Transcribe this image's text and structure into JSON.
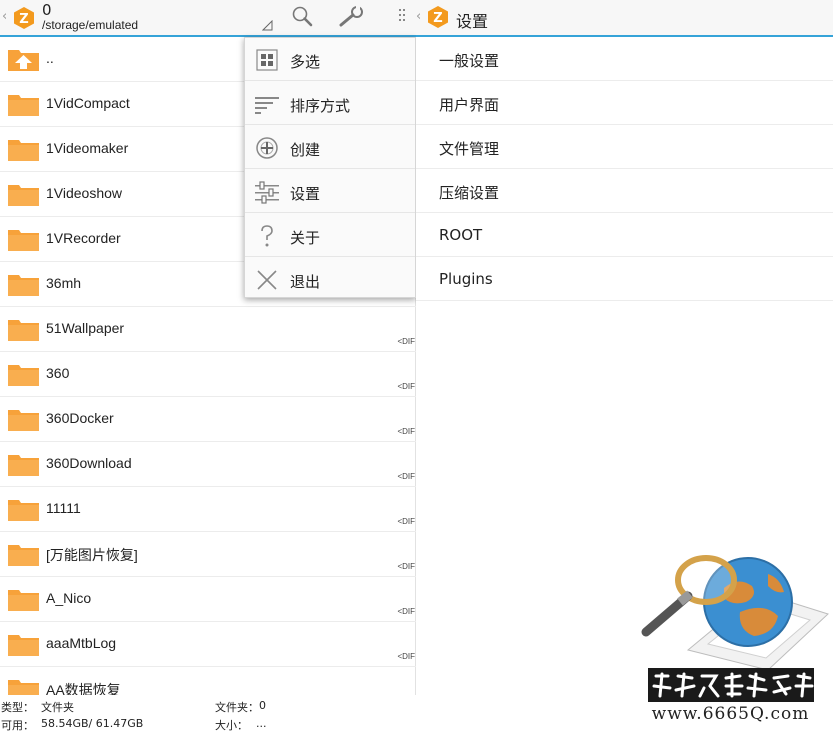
{
  "left_pane": {
    "header": {
      "back_glyph": "‹",
      "logo_letter": "Z",
      "count": "0",
      "path": "/storage/emulated",
      "icons": [
        "sort-triangle-icon",
        "search-icon",
        "wrench-icon",
        "overflow-menu-icon"
      ]
    },
    "files": [
      {
        "name": "..",
        "icon": "up-folder-icon",
        "tag": ""
      },
      {
        "name": "1VidCompact",
        "icon": "folder-icon",
        "tag": ""
      },
      {
        "name": "1Videomaker",
        "icon": "folder-icon",
        "tag": ""
      },
      {
        "name": "1Videoshow",
        "icon": "folder-icon",
        "tag": ""
      },
      {
        "name": "1VRecorder",
        "icon": "folder-icon",
        "tag": ""
      },
      {
        "name": "36mh",
        "icon": "folder-icon",
        "tag": ""
      },
      {
        "name": "51Wallpaper",
        "icon": "folder-icon",
        "tag": "<DIF"
      },
      {
        "name": "360",
        "icon": "folder-icon",
        "tag": "<DIF"
      },
      {
        "name": "360Docker",
        "icon": "folder-icon",
        "tag": "<DIF"
      },
      {
        "name": "360Download",
        "icon": "folder-icon",
        "tag": "<DIF"
      },
      {
        "name": "11111",
        "icon": "folder-icon",
        "tag": "<DIF"
      },
      {
        "name": "[万能图片恢复]",
        "icon": "folder-icon",
        "tag": "<DIF"
      },
      {
        "name": "A_Nico",
        "icon": "folder-icon",
        "tag": "<DIF"
      },
      {
        "name": "aaaMtbLog",
        "icon": "folder-icon",
        "tag": "<DIF"
      },
      {
        "name": "AA数据恢复",
        "icon": "folder-icon",
        "tag": ""
      }
    ],
    "status": {
      "type_label": "类型：",
      "type_value": "文件夹",
      "folders_label": "文件夹：",
      "folders_value": "0",
      "free_label": "可用：",
      "free_value": "58.54GB/ 61.47GB",
      "size_label": "大小：",
      "size_value": "..."
    }
  },
  "popup_menu": {
    "items": [
      {
        "label": "多选",
        "icon": "multi-select-icon"
      },
      {
        "label": "排序方式",
        "icon": "sort-icon"
      },
      {
        "label": "创建",
        "icon": "create-icon"
      },
      {
        "label": "设置",
        "icon": "settings-sliders-icon"
      },
      {
        "label": "关于",
        "icon": "help-icon"
      },
      {
        "label": "退出",
        "icon": "exit-icon"
      }
    ]
  },
  "right_pane": {
    "header": {
      "back_glyph": "‹",
      "logo_letter": "Z",
      "title": "设置"
    },
    "settings_items": [
      "一般设置",
      "用户界面",
      "文件管理",
      "压缩设置",
      "ROOT",
      "Plugins"
    ]
  },
  "watermark": {
    "url": "www.6665Q.com"
  },
  "colors": {
    "accent": "#35a3d8",
    "folder": "#f7a23a",
    "logo": "#f39a1e"
  }
}
